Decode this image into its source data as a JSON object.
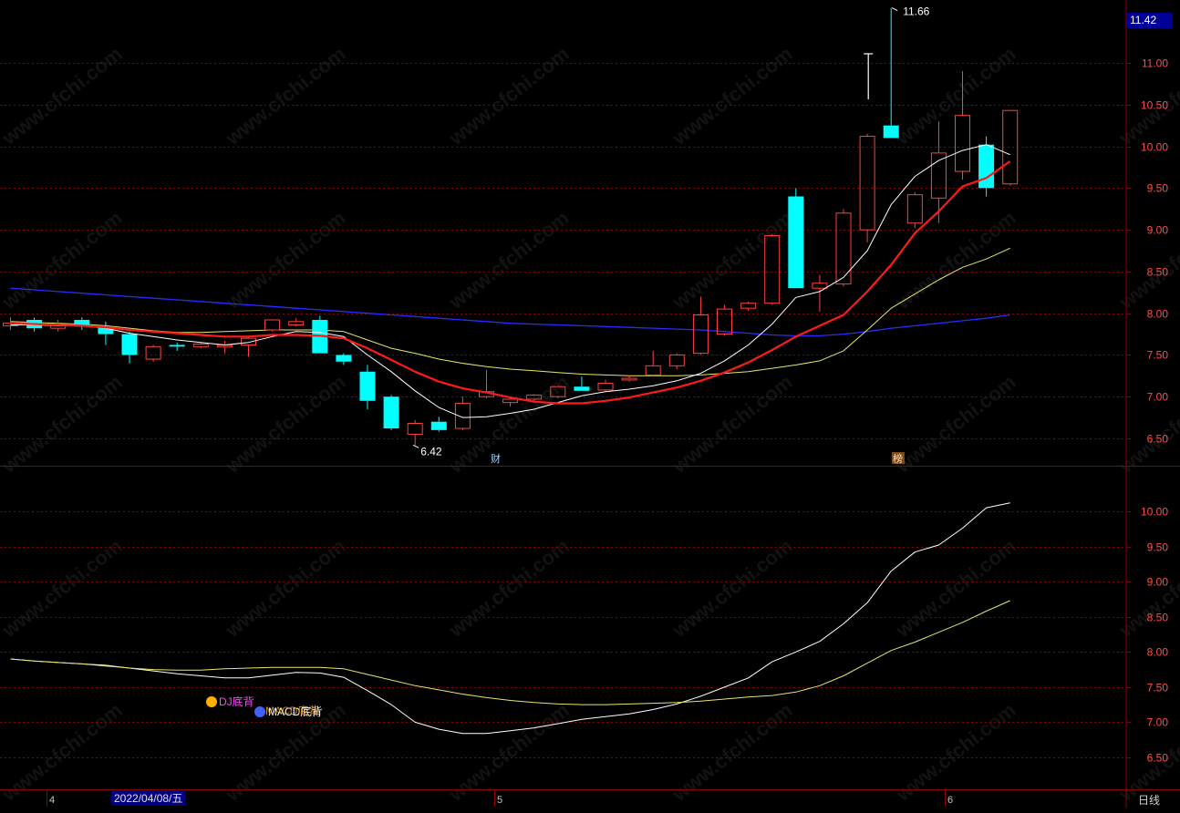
{
  "price_badge": "11.42",
  "period_label": "日线",
  "date_badge": "2022/04/08/五",
  "watermark": "www.cfchi.com",
  "colors": {
    "up": "#ff4040",
    "down": "#00ffff",
    "ma_white": "#ffffff",
    "ma_red": "#ff1a1a",
    "ma_yellow": "#e5e56a",
    "ma_blue": "#2a2aff",
    "grid": "#8b0000",
    "axis_text": "#ff4d4d"
  },
  "chart_data": [
    {
      "type": "candlestick",
      "title": "",
      "ylim": [
        6.25,
        11.75
      ],
      "y_ticks": [
        "11.00",
        "10.50",
        "10.00",
        "9.50",
        "9.00",
        "8.50",
        "8.00",
        "7.50",
        "7.00",
        "6.50"
      ],
      "x_markers": [
        "4",
        "5",
        "6"
      ],
      "candles": [
        {
          "o": 7.85,
          "h": 7.95,
          "l": 7.8,
          "c": 7.88
        },
        {
          "o": 7.92,
          "h": 7.95,
          "l": 7.78,
          "c": 7.82
        },
        {
          "o": 7.82,
          "h": 7.92,
          "l": 7.78,
          "c": 7.86
        },
        {
          "o": 7.92,
          "h": 7.95,
          "l": 7.8,
          "c": 7.84
        },
        {
          "o": 7.83,
          "h": 7.9,
          "l": 7.62,
          "c": 7.75
        },
        {
          "o": 7.75,
          "h": 7.78,
          "l": 7.4,
          "c": 7.5
        },
        {
          "o": 7.45,
          "h": 7.62,
          "l": 7.42,
          "c": 7.6
        },
        {
          "o": 7.62,
          "h": 7.65,
          "l": 7.55,
          "c": 7.6
        },
        {
          "o": 7.6,
          "h": 7.65,
          "l": 7.58,
          "c": 7.63
        },
        {
          "o": 7.6,
          "h": 7.67,
          "l": 7.52,
          "c": 7.62
        },
        {
          "o": 7.62,
          "h": 7.72,
          "l": 7.48,
          "c": 7.7
        },
        {
          "o": 7.8,
          "h": 7.92,
          "l": 7.78,
          "c": 7.92
        },
        {
          "o": 7.86,
          "h": 7.94,
          "l": 7.84,
          "c": 7.9
        },
        {
          "o": 7.92,
          "h": 7.97,
          "l": 7.52,
          "c": 7.52
        },
        {
          "o": 7.5,
          "h": 7.52,
          "l": 7.38,
          "c": 7.42
        },
        {
          "o": 7.3,
          "h": 7.38,
          "l": 6.85,
          "c": 6.95
        },
        {
          "o": 7.0,
          "h": 7.02,
          "l": 6.6,
          "c": 6.62
        },
        {
          "o": 6.55,
          "h": 6.72,
          "l": 6.42,
          "c": 6.68
        },
        {
          "o": 6.7,
          "h": 6.76,
          "l": 6.58,
          "c": 6.6
        },
        {
          "o": 6.62,
          "h": 7.0,
          "l": 6.6,
          "c": 6.92
        },
        {
          "o": 7.0,
          "h": 7.32,
          "l": 6.98,
          "c": 7.06
        },
        {
          "o": 6.93,
          "h": 7.0,
          "l": 6.88,
          "c": 6.97
        },
        {
          "o": 6.97,
          "h": 7.03,
          "l": 6.94,
          "c": 7.02
        },
        {
          "o": 7.0,
          "h": 7.13,
          "l": 6.98,
          "c": 7.12
        },
        {
          "o": 7.12,
          "h": 7.24,
          "l": 7.07,
          "c": 7.07
        },
        {
          "o": 7.08,
          "h": 7.2,
          "l": 7.06,
          "c": 7.16
        },
        {
          "o": 7.2,
          "h": 7.25,
          "l": 7.18,
          "c": 7.22
        },
        {
          "o": 7.26,
          "h": 7.55,
          "l": 7.25,
          "c": 7.37
        },
        {
          "o": 7.37,
          "h": 7.52,
          "l": 7.33,
          "c": 7.5
        },
        {
          "o": 7.52,
          "h": 8.2,
          "l": 7.5,
          "c": 7.98
        },
        {
          "o": 7.75,
          "h": 8.1,
          "l": 7.73,
          "c": 8.05
        },
        {
          "o": 8.06,
          "h": 8.14,
          "l": 8.03,
          "c": 8.12
        },
        {
          "o": 8.12,
          "h": 8.95,
          "l": 8.1,
          "c": 8.93
        },
        {
          "o": 9.4,
          "h": 9.5,
          "l": 8.3,
          "c": 8.3
        },
        {
          "o": 8.3,
          "h": 8.46,
          "l": 8.02,
          "c": 8.36
        },
        {
          "o": 8.35,
          "h": 9.25,
          "l": 8.32,
          "c": 9.2
        },
        {
          "o": 9.0,
          "h": 10.15,
          "l": 8.85,
          "c": 10.12
        },
        {
          "o": 10.25,
          "h": 11.66,
          "l": 10.1,
          "c": 10.1
        },
        {
          "o": 9.08,
          "h": 9.45,
          "l": 9.02,
          "c": 9.42
        },
        {
          "o": 9.38,
          "h": 10.3,
          "l": 9.08,
          "c": 9.92
        },
        {
          "o": 9.7,
          "h": 10.9,
          "l": 9.6,
          "c": 10.37
        },
        {
          "o": 10.02,
          "h": 10.12,
          "l": 9.4,
          "c": 9.5
        },
        {
          "o": 9.55,
          "h": 10.43,
          "l": 9.53,
          "c": 10.43
        }
      ],
      "ma_white": [
        7.86,
        7.86,
        7.85,
        7.85,
        7.82,
        7.76,
        7.72,
        7.68,
        7.65,
        7.62,
        7.65,
        7.72,
        7.78,
        7.77,
        7.72,
        7.5,
        7.3,
        7.07,
        6.87,
        6.75,
        6.76,
        6.8,
        6.85,
        6.93,
        7.01,
        7.06,
        7.09,
        7.13,
        7.19,
        7.28,
        7.43,
        7.62,
        7.87,
        8.19,
        8.26,
        8.43,
        8.75,
        9.3,
        9.64,
        9.83,
        9.95,
        10.02,
        9.9
      ],
      "ma_red": [
        7.88,
        7.87,
        7.86,
        7.85,
        7.83,
        7.8,
        7.78,
        7.76,
        7.74,
        7.72,
        7.72,
        7.74,
        7.74,
        7.73,
        7.7,
        7.58,
        7.44,
        7.3,
        7.18,
        7.1,
        7.05,
        6.99,
        6.94,
        6.92,
        6.92,
        6.95,
        6.99,
        7.05,
        7.11,
        7.19,
        7.29,
        7.41,
        7.56,
        7.72,
        7.85,
        7.98,
        8.26,
        8.58,
        8.96,
        9.22,
        9.52,
        9.62,
        9.82
      ],
      "ma_yellow": [
        7.9,
        7.89,
        7.88,
        7.87,
        7.85,
        7.82,
        7.79,
        7.77,
        7.77,
        7.78,
        7.79,
        7.8,
        7.8,
        7.8,
        7.78,
        7.68,
        7.58,
        7.52,
        7.45,
        7.4,
        7.36,
        7.33,
        7.31,
        7.29,
        7.27,
        7.26,
        7.25,
        7.25,
        7.25,
        7.26,
        7.28,
        7.3,
        7.34,
        7.38,
        7.43,
        7.55,
        7.8,
        8.06,
        8.23,
        8.4,
        8.55,
        8.65,
        8.78
      ],
      "ma_blue": [
        8.3,
        8.28,
        8.26,
        8.24,
        8.22,
        8.2,
        8.18,
        8.16,
        8.14,
        8.12,
        8.1,
        8.08,
        8.06,
        8.04,
        8.02,
        8.0,
        7.98,
        7.96,
        7.94,
        7.92,
        7.9,
        7.88,
        7.87,
        7.86,
        7.85,
        7.84,
        7.83,
        7.82,
        7.81,
        7.8,
        7.78,
        7.76,
        7.74,
        7.73,
        7.73,
        7.75,
        7.78,
        7.82,
        7.85,
        7.88,
        7.91,
        7.94,
        7.98
      ],
      "annotations": {
        "high": "11.66",
        "low": "6.42",
        "marker_cai": "财",
        "marker_bang": "榜"
      }
    },
    {
      "type": "line",
      "title": "",
      "ylim": [
        6.25,
        10.5
      ],
      "y_ticks": [
        "10.00",
        "9.50",
        "9.00",
        "8.50",
        "8.00",
        "7.50",
        "7.00",
        "6.50"
      ],
      "series": [
        {
          "values": [
            7.9,
            7.87,
            7.85,
            7.83,
            7.81,
            7.77,
            7.73,
            7.69,
            7.66,
            7.63,
            7.63,
            7.67,
            7.71,
            7.7,
            7.64,
            7.45,
            7.25,
            7.0,
            6.9,
            6.84,
            6.84,
            6.88,
            6.92,
            6.98,
            7.04,
            7.08,
            7.12,
            7.18,
            7.26,
            7.37,
            7.5,
            7.63,
            7.86,
            8.0,
            8.15,
            8.4,
            8.7,
            9.15,
            9.42,
            9.52,
            9.76,
            10.05,
            10.12
          ],
          "color": "#ffffff"
        },
        {
          "values": [
            7.9,
            7.87,
            7.85,
            7.83,
            7.8,
            7.77,
            7.75,
            7.74,
            7.74,
            7.76,
            7.77,
            7.78,
            7.78,
            7.78,
            7.76,
            7.68,
            7.6,
            7.52,
            7.46,
            7.4,
            7.35,
            7.31,
            7.28,
            7.26,
            7.25,
            7.25,
            7.26,
            7.27,
            7.28,
            7.3,
            7.33,
            7.36,
            7.38,
            7.43,
            7.52,
            7.66,
            7.84,
            8.02,
            8.14,
            8.28,
            8.42,
            8.58,
            8.73
          ],
          "color": "#e5e56a"
        }
      ],
      "signals": {
        "signal_dj": "DJ底背",
        "signal_macd": "MACD底背",
        "signal_kd": "MACD底背"
      }
    }
  ]
}
